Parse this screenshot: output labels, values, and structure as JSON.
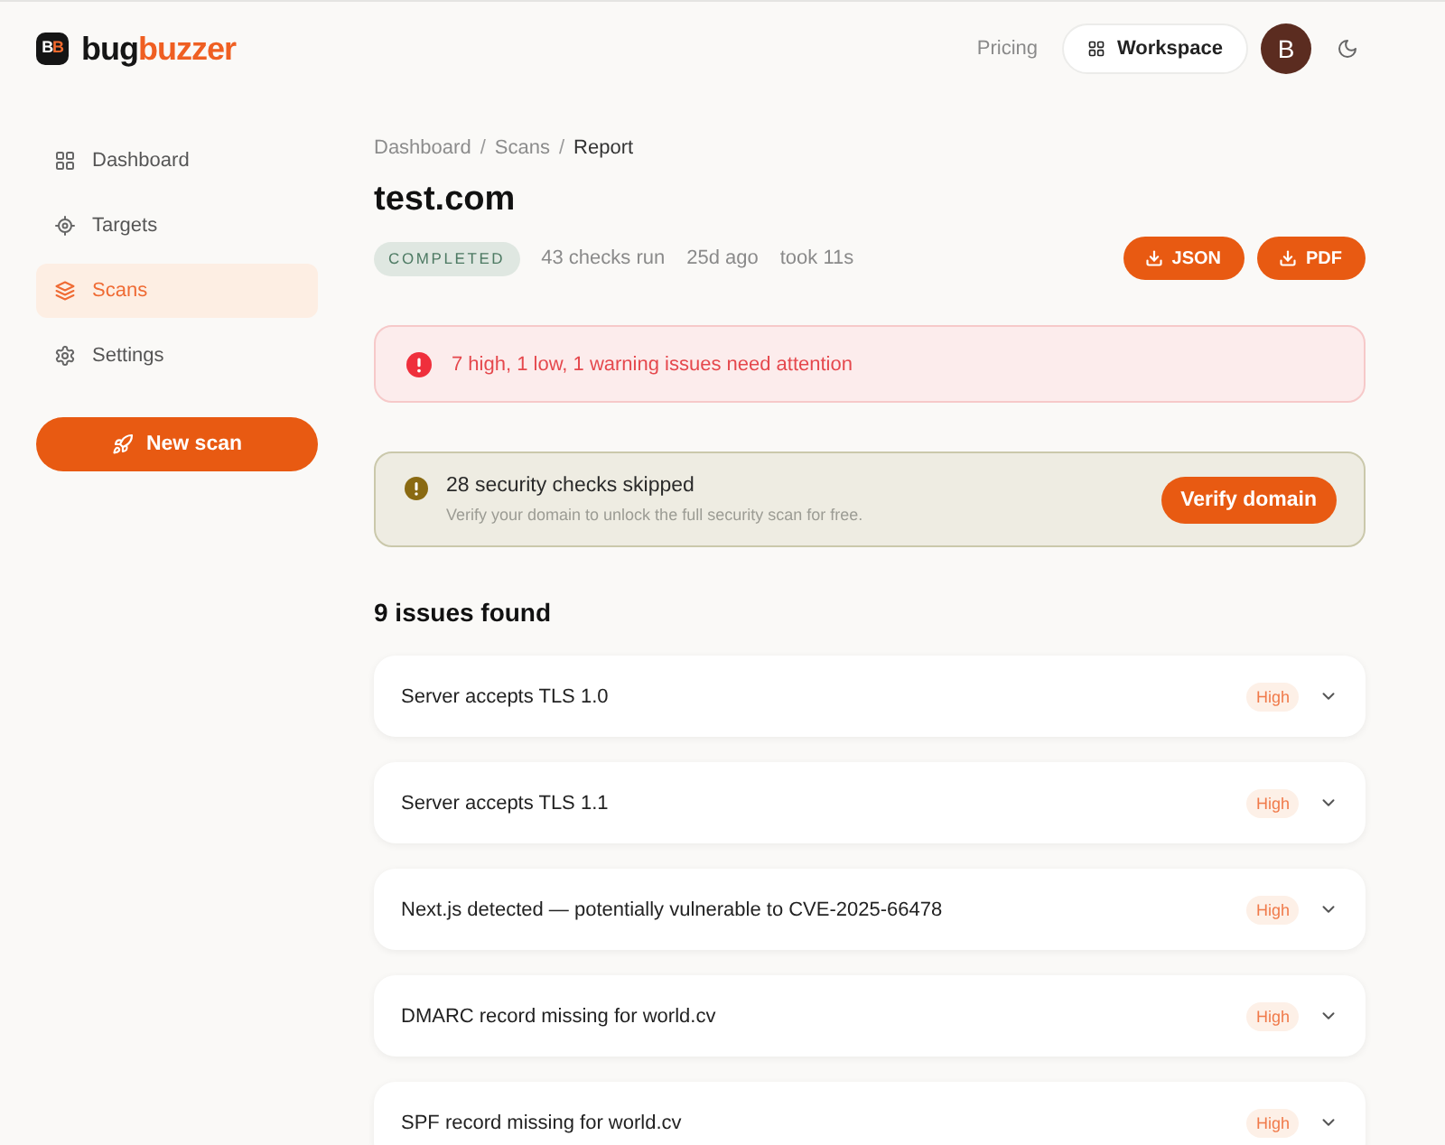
{
  "header": {
    "logo": {
      "mark": [
        "B",
        "B"
      ],
      "wordmark": [
        "bug",
        "buzzer"
      ]
    },
    "nav_link": "Pricing",
    "workspace_button": "Workspace",
    "avatar_initial": "B"
  },
  "sidebar": {
    "items": [
      {
        "label": "Dashboard",
        "selected": false
      },
      {
        "label": "Targets",
        "selected": false
      },
      {
        "label": "Scans",
        "selected": true
      },
      {
        "label": "Settings",
        "selected": false
      }
    ],
    "new_scan_button": "New scan"
  },
  "breadcrumb": [
    {
      "kind": "link",
      "label": "Dashboard"
    },
    {
      "kind": "separator",
      "label": "/"
    },
    {
      "kind": "link",
      "label": "Scans"
    },
    {
      "kind": "separator",
      "label": "/"
    },
    {
      "kind": "current",
      "label": "Report"
    }
  ],
  "report": {
    "title": "test.com",
    "status": "COMPLETED",
    "meta": [
      "43 checks run",
      "25d ago",
      "took 11s"
    ],
    "export_buttons": [
      "JSON",
      "PDF"
    ]
  },
  "alert": {
    "text": "7 high, 1 low, 1 warning issues need attention"
  },
  "notice": {
    "title": "28 security checks skipped",
    "subtitle": "Verify your domain to unlock the full security scan for free.",
    "button": "Verify domain"
  },
  "issues": {
    "heading": "9 issues found",
    "items": [
      {
        "title": "Server accepts TLS 1.0",
        "severity": "High"
      },
      {
        "title": "Server accepts TLS 1.1",
        "severity": "High"
      },
      {
        "title": "Next.js detected — potentially vulnerable to CVE-2025-66478",
        "severity": "High"
      },
      {
        "title": "DMARC record missing for world.cv",
        "severity": "High"
      },
      {
        "title": "SPF record missing for world.cv",
        "severity": "High"
      }
    ]
  }
}
